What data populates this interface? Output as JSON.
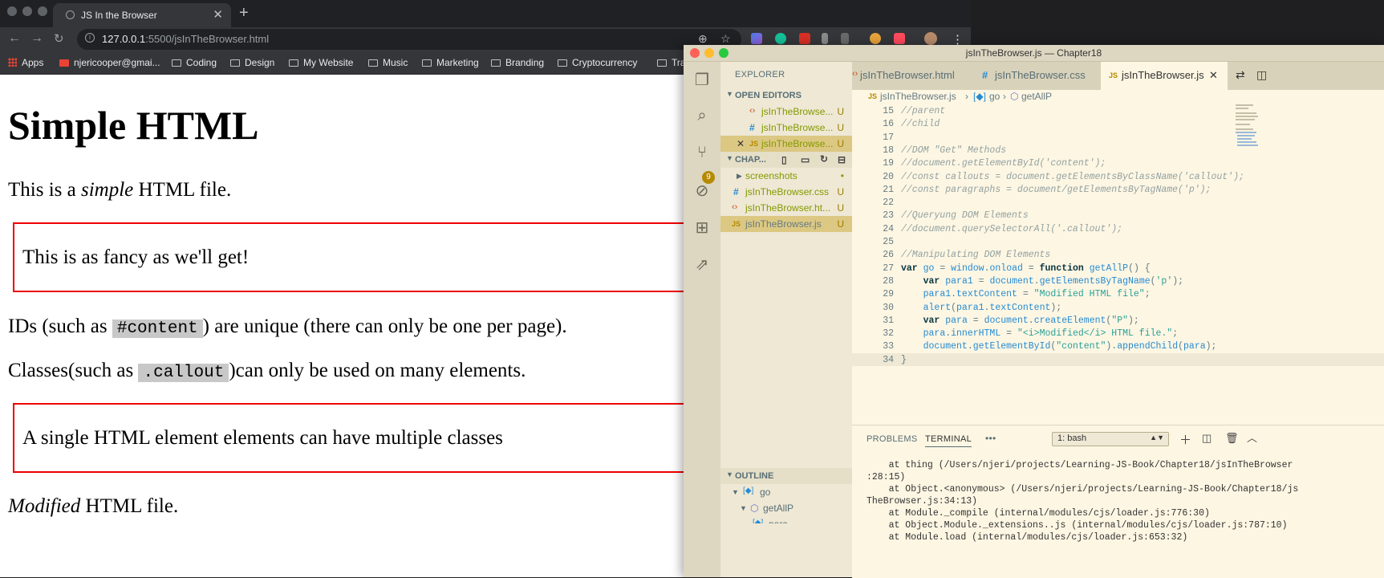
{
  "chrome": {
    "tab_title": "JS In the Browser",
    "url_host": "127.0.0.1",
    "url_path": ":5500/jsInTheBrowser.html",
    "bookmarks": [
      {
        "label": "Apps",
        "icon": "apps-grid-icon"
      },
      {
        "label": "njericooper@gmai...",
        "icon": "gmail-icon"
      },
      {
        "label": "Coding",
        "icon": "folder-icon"
      },
      {
        "label": "Design",
        "icon": "folder-icon"
      },
      {
        "label": "My Website",
        "icon": "folder-icon"
      },
      {
        "label": "Music",
        "icon": "folder-icon"
      },
      {
        "label": "Marketing",
        "icon": "folder-icon"
      },
      {
        "label": "Branding",
        "icon": "folder-icon"
      },
      {
        "label": "Cryptocurrency",
        "icon": "folder-icon"
      },
      {
        "label": "Trad",
        "icon": "folder-icon"
      }
    ]
  },
  "page": {
    "heading": "Simple HTML",
    "p1_before": "This is a ",
    "p1_em": "simple",
    "p1_after": " HTML file.",
    "callout1": "This is as fancy as we'll get!",
    "p2_before": "IDs (such as ",
    "p2_code": "#content",
    "p2_after": ") are unique (there can only be one per page).",
    "p3_before": "Classes(such as ",
    "p3_code": ".callout",
    "p3_after": ")can only be used on many elements.",
    "callout2": "A single HTML element elements can have multiple classes",
    "p4_em": "Modified",
    "p4_after": " HTML file."
  },
  "vscode": {
    "window_title": "jsInTheBrowser.js — Chapter18",
    "explorer_title": "EXPLORER",
    "open_editors_label": "OPEN EDITORS",
    "open_editors": [
      {
        "name": "jsInTheBrowse...",
        "status": "U",
        "type": "html"
      },
      {
        "name": "jsInTheBrowse...",
        "status": "U",
        "type": "css"
      },
      {
        "name": "jsInTheBrowse...",
        "status": "U",
        "type": "js"
      }
    ],
    "folder_label": "CHAP...",
    "files": [
      {
        "name": "screenshots",
        "status": "•",
        "type": "folder"
      },
      {
        "name": "jsInTheBrowser.css",
        "status": "U",
        "type": "css"
      },
      {
        "name": "jsInTheBrowser.ht...",
        "status": "U",
        "type": "html"
      },
      {
        "name": "jsInTheBrowser.js",
        "status": "U",
        "type": "js"
      }
    ],
    "outline_label": "OUTLINE",
    "outline_items": [
      "go",
      "getAllP",
      "para"
    ],
    "scm_badge": "9",
    "tabs": [
      "jsInTheBrowser.html",
      "jsInTheBrowser.css",
      "jsInTheBrowser.js"
    ],
    "breadcrumb": [
      "jsInTheBrowser.js",
      "go",
      "getAllP"
    ],
    "code_lines": [
      {
        "n": "15",
        "text": "//parent"
      },
      {
        "n": "16",
        "text": "//child"
      },
      {
        "n": "17",
        "text": ""
      },
      {
        "n": "18",
        "text": "//DOM \"Get\" Methods"
      },
      {
        "n": "19",
        "text": "//document.getElementById('content');"
      },
      {
        "n": "20",
        "text": "//const callouts = document.getElementsByClassName('callout');"
      },
      {
        "n": "21",
        "text": "//const paragraphs = document/getElementsByTagName('p');"
      },
      {
        "n": "22",
        "text": ""
      },
      {
        "n": "23",
        "text": "//Queryung DOM Elements"
      },
      {
        "n": "24",
        "text": "//document.querySelectorAll('.callout');"
      },
      {
        "n": "25",
        "text": ""
      },
      {
        "n": "26",
        "text": "//Manipulating DOM Elements"
      },
      {
        "n": "27",
        "text": "var go = window.onload = function getAllP() {"
      },
      {
        "n": "28",
        "text": "    var para1 = document.getElementsByTagName('p');"
      },
      {
        "n": "29",
        "text": "    para1.textContent = \"Modified HTML file\";"
      },
      {
        "n": "30",
        "text": "    alert(para1.textContent);"
      },
      {
        "n": "31",
        "text": "    var para = document.createElement(\"P\");"
      },
      {
        "n": "32",
        "text": "    para.innerHTML = \"<i>Modified</i> HTML file.\";"
      },
      {
        "n": "33",
        "text": "    document.getElementById(\"content\").appendChild(para);"
      },
      {
        "n": "34",
        "text": "}"
      }
    ],
    "panel_tabs": [
      "PROBLEMS",
      "TERMINAL",
      "•••"
    ],
    "terminal_select": "1: bash",
    "terminal_lines": [
      "    at thing (/Users/njeri/projects/Learning-JS-Book/Chapter18/jsInTheBrowser",
      ":28:15)",
      "    at Object.<anonymous> (/Users/njeri/projects/Learning-JS-Book/Chapter18/js",
      "TheBrowser.js:34:13)",
      "    at Module._compile (internal/modules/cjs/loader.js:776:30)",
      "    at Object.Module._extensions..js (internal/modules/cjs/loader.js:787:10)",
      "    at Module.load (internal/modules/cjs/loader.js:653:32)"
    ]
  }
}
